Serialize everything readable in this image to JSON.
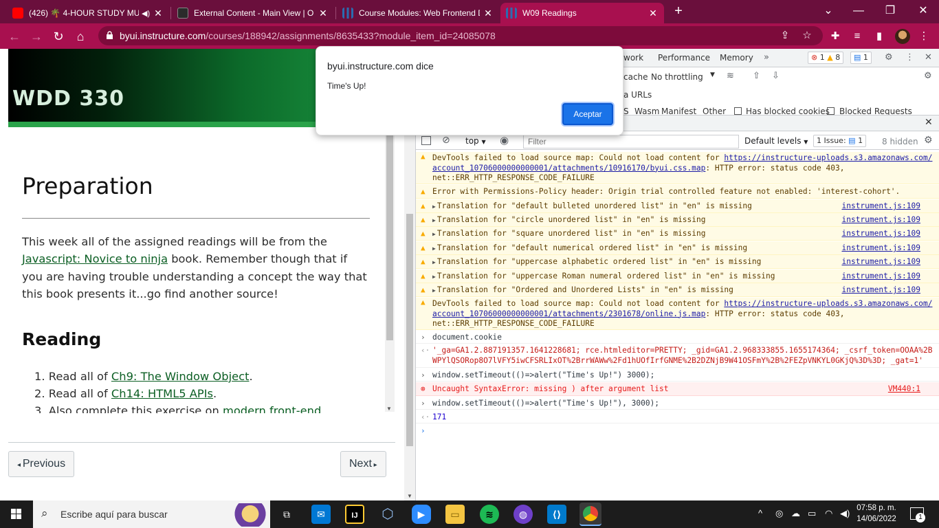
{
  "browser": {
    "tabs": [
      {
        "title": "(426) 🌴 4-HOUR STUDY MU",
        "active": false
      },
      {
        "title": "External Content - Main View | O",
        "active": false
      },
      {
        "title": "Course Modules: Web Frontend D",
        "active": false
      },
      {
        "title": "W09 Readings",
        "active": true
      }
    ],
    "url_host": "byui.instructure.com",
    "url_path": "/courses/188942/assignments/8635433?module_item_id=24085078",
    "accent_color": "#a8104f"
  },
  "page": {
    "banner_title": "WDD 330",
    "preparation_title": "Preparation",
    "prep_text_1": "This week all of the assigned readings will be from the",
    "prep_link": "Javascript: Novice to ninja",
    "prep_text_2": " book. Remember though that if you are having trouble understanding a concept the way that this book presents it...go find another source!",
    "reading_title": "Reading",
    "readings": [
      {
        "num": "1.",
        "prefix": "Read all of ",
        "link": "Ch9: The Window Object",
        "suffix": "."
      },
      {
        "num": "2.",
        "prefix": "Read all of ",
        "link": "Ch14: HTML5 APIs",
        "suffix": "."
      },
      {
        "num": "3.",
        "prefix": "Also complete this exercise on ",
        "link": "modern front-end",
        "suffix": ""
      }
    ],
    "previous_label": "Previous",
    "next_label": "Next"
  },
  "dialog": {
    "title": "byui.instructure.com dice",
    "message": "Time's Up!",
    "ok_label": "Aceptar"
  },
  "devtools": {
    "tabs": [
      "work",
      "Performance",
      "Memory"
    ],
    "errors_count": "1",
    "warnings_count": "8",
    "issues_count": "1",
    "network_cache": "cache",
    "throttling": "No throttling",
    "data_urls": "a URLs",
    "filter_types": [
      "S",
      "Wasm",
      "Manifest",
      "Other"
    ],
    "blocked_cookies": "Has blocked cookies",
    "blocked_requests": "Blocked Requests",
    "context": "top",
    "filter_placeholder": "Filter",
    "levels": "Default levels",
    "issue_label": "1 Issue:",
    "issue_num": "1",
    "hidden": "8 hidden",
    "console": {
      "warn1_a": "DevTools failed to load source map: Could not load content for ",
      "warn1_link1": "https://instructure-uploads.s3.amazonaws.com/",
      "warn1_link2": "account_10706000000000001/attachments/10916170/byui.css.map",
      "warn1_b": ": HTTP error: status code 403,",
      "warn1_c": "net::ERR_HTTP_RESPONSE_CODE_FAILURE",
      "warn2": "Error with Permissions-Policy header: Origin trial controlled feature not enabled: 'interest-cohort'.",
      "translations": [
        "Translation for \"default bulleted unordered list\" in \"en\" is missing",
        "Translation for \"circle unordered list\" in \"en\" is missing",
        "Translation for \"square unordered list\" in \"en\" is missing",
        "Translation for \"default numerical ordered list\" in \"en\" is missing",
        "Translation for \"uppercase alphabetic ordered list\" in \"en\" is missing",
        "Translation for \"uppercase Roman numeral ordered list\" in \"en\" is missing",
        "Translation for \"Ordered and Unordered Lists\" in \"en\" is missing"
      ],
      "translation_source": "instrument.js:109",
      "warn3_a": "DevTools failed to load source map: Could not load content for ",
      "warn3_link1": "https://instructure-uploads.s3.amazonaws.com/",
      "warn3_link2": "account_10706000000000001/attachments/2301678/online.js.map",
      "warn3_b": ": HTTP error: status code 403,",
      "warn3_c": "net::ERR_HTTP_RESPONSE_CODE_FAILURE",
      "cmd1": "document.cookie",
      "cookie_line1": "'_ga=GA1.2.887191357.1641228681; rce.htmleditor=PRETTY; _gid=GA1.2.968333855.1655174364; _csrf_token=OOAA%2B",
      "cookie_line2": "WPYlQSORop8O7lVFY5iwCFSRLIxOT%2BrrWAWw%2Fd1hUOfIrfGNME%2B2DZNjB9W41OSFmY%2B%2FEZpVNKYL0GKjQ%3D%3D; _gat=1'",
      "cmd2": "window.setTimeout(()=>alert(\"Time's Up!\") 3000);",
      "err_msg": "Uncaught SyntaxError: missing ) after argument list",
      "err_source": "VM440:1",
      "cmd3": "window.setTimeout(()=>alert(\"Time's Up!\"), 3000);",
      "result": "171"
    }
  },
  "taskbar": {
    "search_placeholder": "Escribe aquí para buscar",
    "time": "07:58 p. m.",
    "date": "14/06/2022",
    "notifications": "1",
    "apps": [
      "task-view",
      "mail",
      "jetbrains",
      "virtualbox",
      "zoom",
      "file-explorer",
      "spotify",
      "github",
      "vscode",
      "chrome"
    ]
  }
}
